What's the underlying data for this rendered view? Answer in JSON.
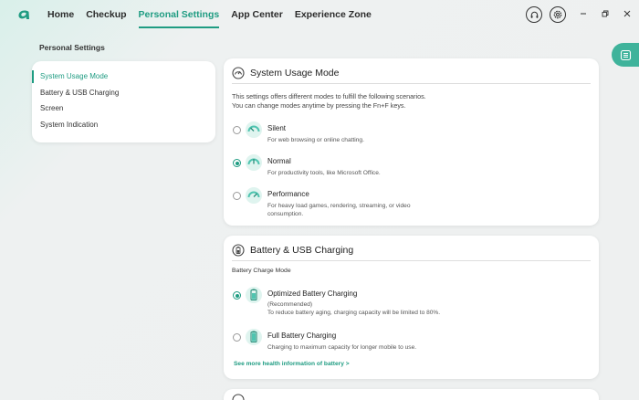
{
  "nav": {
    "tabs": [
      {
        "label": "Home"
      },
      {
        "label": "Checkup"
      },
      {
        "label": "Personal Settings"
      },
      {
        "label": "App Center"
      },
      {
        "label": "Experience Zone"
      }
    ],
    "active_index": 2
  },
  "sidebar": {
    "heading": "Personal Settings",
    "items": [
      {
        "label": "System Usage Mode"
      },
      {
        "label": "Battery & USB Charging"
      },
      {
        "label": "Screen"
      },
      {
        "label": "System Indication"
      }
    ]
  },
  "usage_mode": {
    "title": "System Usage Mode",
    "desc_line1": "This settings offers different modes to fulfill the following scenarios.",
    "desc_line2": "You can change modes anytime by pressing the Fn+F keys.",
    "options": [
      {
        "title": "Silent",
        "sub": "For web browsing or online chatting.",
        "checked": false
      },
      {
        "title": "Normal",
        "sub": "For productivity tools, like Microsoft Office.",
        "checked": true
      },
      {
        "title": "Performance",
        "sub_line1": "For heavy load games, rendering, streaming, or video",
        "sub_line2": "consumption.",
        "checked": false
      }
    ]
  },
  "battery": {
    "title": "Battery & USB Charging",
    "section_label": "Battery Charge Mode",
    "options": [
      {
        "title": "Optimized Battery Charging",
        "sub_line1": "(Recommended)",
        "sub_line2": "To reduce battery aging, charging capacity will be limited to 80%.",
        "checked": true
      },
      {
        "title": "Full Battery Charging",
        "sub": "Charging to maximum capacity for longer mobile to use.",
        "checked": false
      }
    ],
    "link": "See more health information of battery >"
  },
  "colors": {
    "accent": "#1f9c82",
    "accent_light": "#3fb39b",
    "icon_tint": "#4fc4b0"
  },
  "icons": [
    "acer-logo-icon",
    "headset-icon",
    "gear-icon",
    "minimize-icon",
    "restore-icon",
    "close-icon",
    "list-icon",
    "gauge-icon",
    "battery-icon"
  ]
}
